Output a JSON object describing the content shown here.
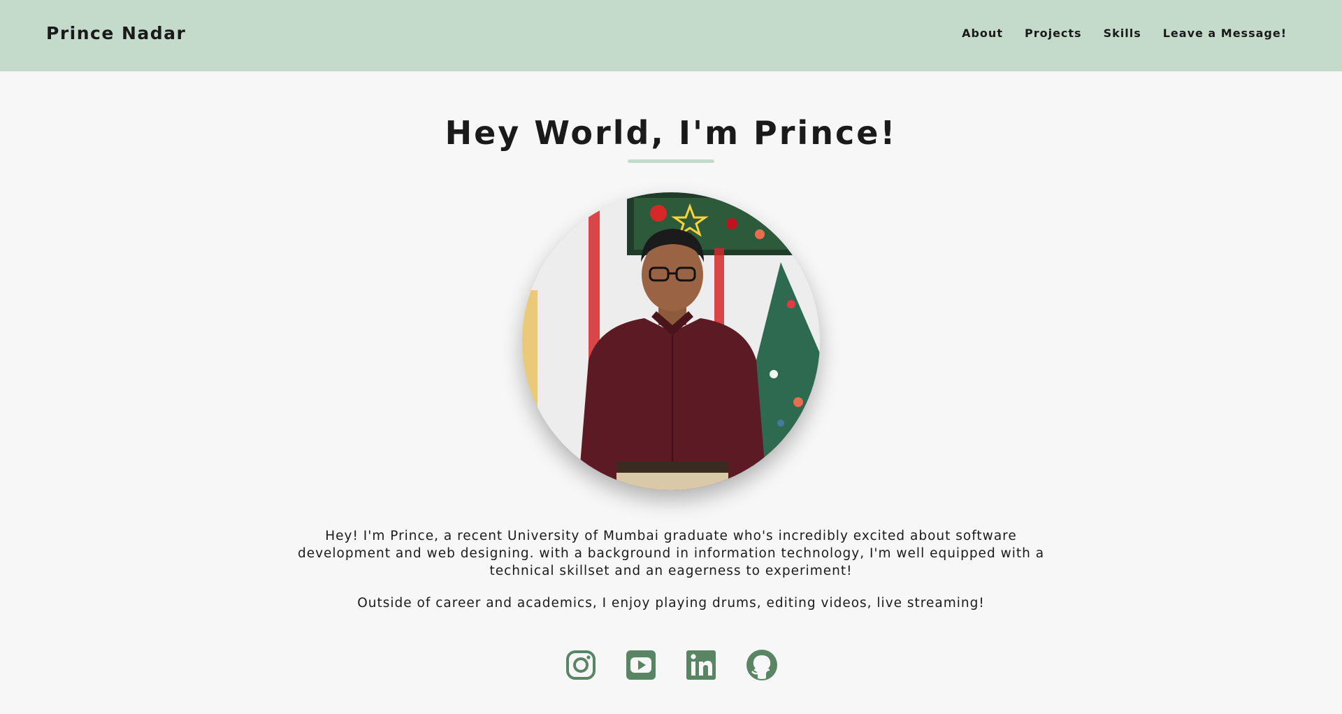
{
  "navbar": {
    "brand": "Prince Nadar",
    "links": [
      "About",
      "Projects",
      "Skills",
      "Leave a Message!"
    ]
  },
  "hero": {
    "title": "Hey World, I'm Prince!",
    "bio_paragraph_1": "Hey! I'm Prince, a recent University of Mumbai graduate who's incredibly excited about software development and web designing. with a background in information technology, I'm well equipped with a technical skillset and an eagerness to experiment!",
    "bio_paragraph_2": "Outside of career and academics, I enjoy playing drums, editing videos, live streaming!"
  },
  "socials": [
    {
      "icon": "instagram-icon"
    },
    {
      "icon": "youtube-icon"
    },
    {
      "icon": "linkedin-icon"
    },
    {
      "icon": "github-icon"
    }
  ],
  "colors": {
    "navbar_bg": "#c4dacb",
    "page_bg": "#f7f7f7",
    "accent": "#c4dacb",
    "icon_color": "#5a8565",
    "text": "#1a1a1a"
  }
}
